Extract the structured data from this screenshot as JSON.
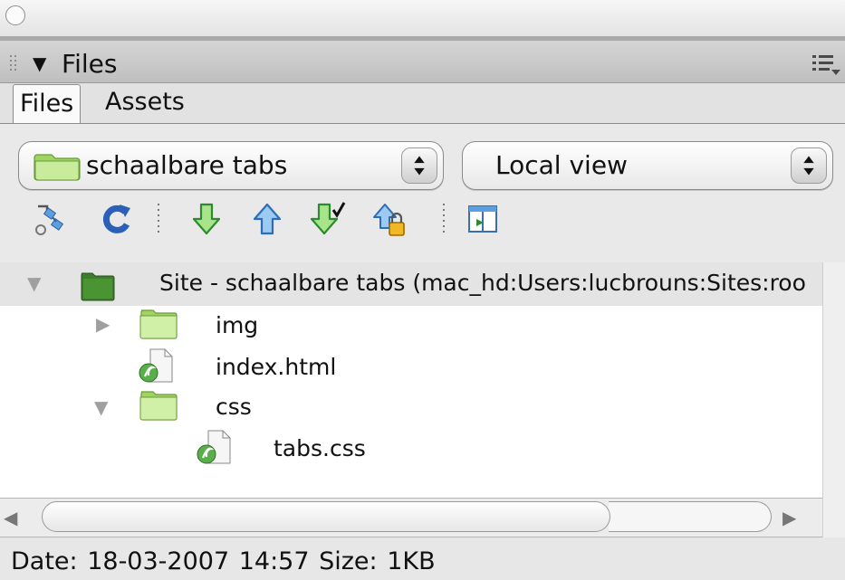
{
  "panel": {
    "title": "Files"
  },
  "tabs": [
    {
      "label": "Files",
      "selected": true
    },
    {
      "label": "Assets",
      "selected": false
    }
  ],
  "site_select": {
    "value": "schaalbare tabs"
  },
  "view_select": {
    "value": "Local view"
  },
  "toolbar": {
    "icons": [
      "connect-icon",
      "refresh-icon",
      "get-files-icon",
      "put-files-icon",
      "check-out-icon",
      "check-in-icon",
      "expand-site-icon"
    ]
  },
  "tree": {
    "site": {
      "label": "Site - schaalbare tabs (mac_hd:Users:lucbrouns:Sites:roo"
    },
    "items": [
      {
        "label": "img",
        "type": "folder",
        "expanded": false
      },
      {
        "label": "index.html",
        "type": "file"
      },
      {
        "label": "css",
        "type": "folder",
        "expanded": true
      },
      {
        "label": "tabs.css",
        "type": "file"
      }
    ]
  },
  "status": {
    "text": "Date: 18-03-2007 14:57  Size: 1KB"
  },
  "colors": {
    "folder_green": "#9fd463",
    "arrow_green": "#3bb43b",
    "arrow_blue": "#3c8de0",
    "site_folder": "#3e7d2c"
  }
}
